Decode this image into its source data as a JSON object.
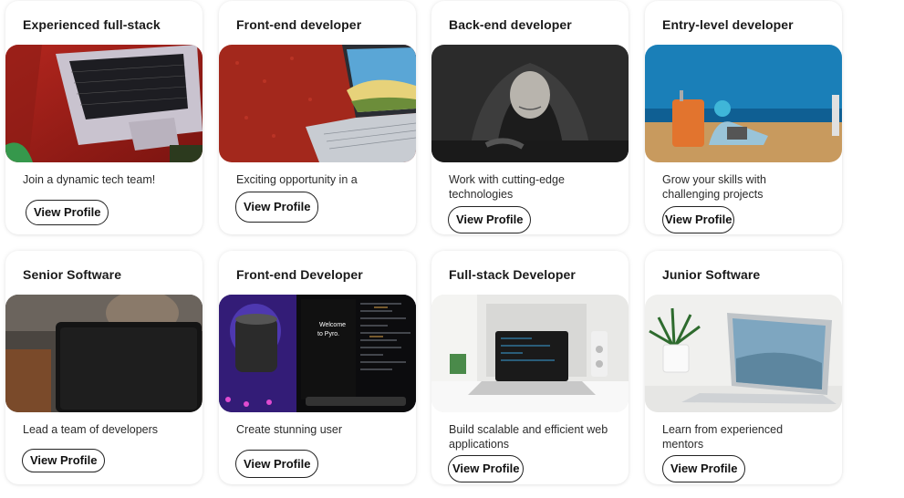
{
  "cards": [
    {
      "title": "Experienced full-stack",
      "description": "Join a dynamic tech team!",
      "button_label": "View Profile",
      "image": "laptop-on-red-desk"
    },
    {
      "title": "Front-end developer",
      "description": "Exciting opportunity in a",
      "button_label": "View Profile",
      "image": "laptop-on-red-surface"
    },
    {
      "title": "Back-end developer",
      "description": "Work with cutting-edge technologies",
      "button_label": "View Profile",
      "image": "hooded-hacker-mask"
    },
    {
      "title": "Entry-level developer",
      "description": "Grow your skills with challenging projects",
      "button_label": "View Profile",
      "image": "laptop-on-beach"
    },
    {
      "title": "Senior Software",
      "description": "Lead a team of developers",
      "button_label": "View Profile",
      "image": "person-behind-laptop"
    },
    {
      "title": "Front-end Developer",
      "description": "Create stunning user",
      "button_label": "View Profile",
      "image": "code-editor-screen-neon"
    },
    {
      "title": "Full-stack Developer",
      "description": "Build scalable and efficient web applications",
      "button_label": "View Profile",
      "image": "laptop-code-white-desk"
    },
    {
      "title": "Junior Software",
      "description": "Learn from experienced mentors",
      "button_label": "View Profile",
      "image": "macbook-with-plant"
    }
  ],
  "image_text": {
    "screen_welcome": "Welcome",
    "screen_to": "to Pyro."
  },
  "colors": {
    "card_bg": "#ffffff",
    "button_border": "#222222",
    "text": "#1a1a1a"
  }
}
